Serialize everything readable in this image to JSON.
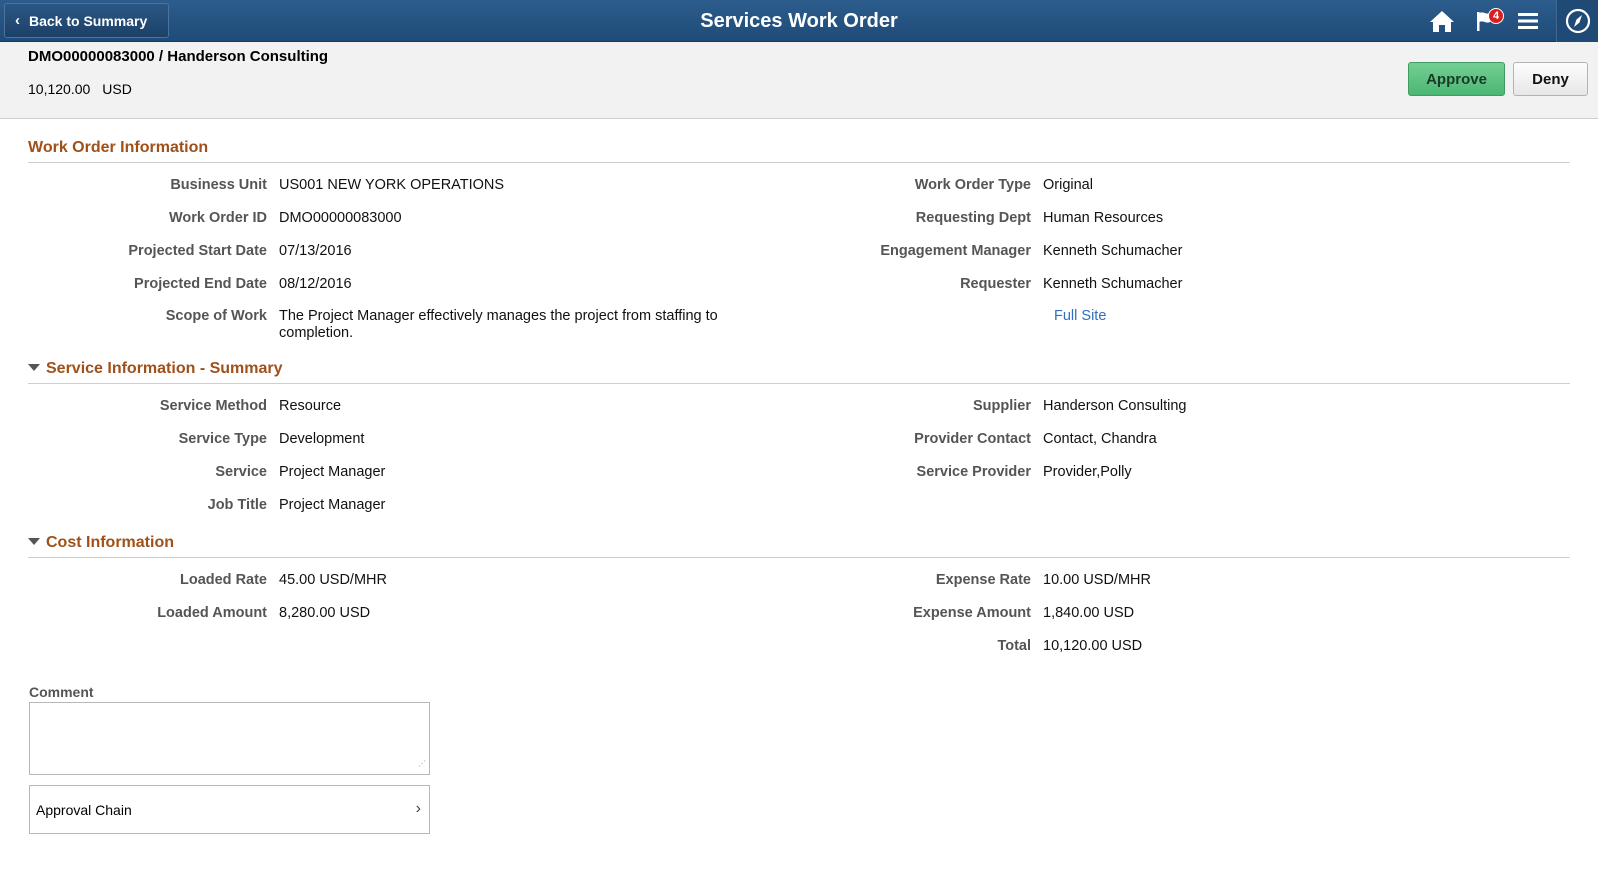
{
  "banner": {
    "back_label": "Back to Summary",
    "title": "Services Work Order",
    "notification_count": "4"
  },
  "summary": {
    "title": "DMO00000083000 / Handerson Consulting",
    "amount": "10,120.00",
    "currency": "USD",
    "approve_label": "Approve",
    "deny_label": "Deny"
  },
  "work_order": {
    "heading": "Work Order Information",
    "left": [
      {
        "label": "Business Unit",
        "value": "US001 NEW YORK OPERATIONS"
      },
      {
        "label": "Work Order ID",
        "value": "DMO00000083000"
      },
      {
        "label": "Projected Start Date",
        "value": "07/13/2016"
      },
      {
        "label": "Projected End Date",
        "value": "08/12/2016"
      },
      {
        "label": "Scope of Work",
        "value": "The Project Manager effectively manages the project from staffing to completion."
      }
    ],
    "right": [
      {
        "label": "Work Order Type",
        "value": "Original"
      },
      {
        "label": "Requesting Dept",
        "value": "Human Resources"
      },
      {
        "label": "Engagement Manager",
        "value": "Kenneth Schumacher"
      },
      {
        "label": "Requester",
        "value": "Kenneth Schumacher"
      }
    ],
    "full_site_link": "Full Site"
  },
  "service_info": {
    "heading": "Service Information - Summary",
    "left": [
      {
        "label": "Service Method",
        "value": "Resource"
      },
      {
        "label": "Service Type",
        "value": "Development"
      },
      {
        "label": "Service",
        "value": "Project Manager"
      },
      {
        "label": "Job Title",
        "value": "Project Manager"
      }
    ],
    "right": [
      {
        "label": "Supplier",
        "value": "Handerson Consulting"
      },
      {
        "label": "Provider Contact",
        "value": "Contact, Chandra"
      },
      {
        "label": "Service Provider",
        "value": "Provider,Polly"
      }
    ]
  },
  "cost_info": {
    "heading": "Cost Information",
    "left": [
      {
        "label": "Loaded Rate",
        "value": "45.00 USD/MHR"
      },
      {
        "label": "Loaded Amount",
        "value": "8,280.00 USD"
      }
    ],
    "right": [
      {
        "label": "Expense Rate",
        "value": "10.00 USD/MHR"
      },
      {
        "label": "Expense Amount",
        "value": "1,840.00 USD"
      },
      {
        "label": "Total",
        "value": "10,120.00 USD"
      }
    ]
  },
  "comment": {
    "label": "Comment",
    "value": ""
  },
  "approval_chain_label": "Approval Chain",
  "icons": {
    "back": "chevron-left-icon",
    "home": "home-icon",
    "notifications": "flag-icon",
    "menu": "hamburger-menu-icon",
    "navbar": "compass-icon",
    "collapse": "triangle-down-icon",
    "approval_chain": "chevron-right-icon"
  },
  "colors": {
    "banner": "#1f4b78",
    "section_heading": "#a0501a",
    "approve_button": "#5cbf80",
    "link": "#2f6fc2",
    "badge": "#d92020"
  }
}
